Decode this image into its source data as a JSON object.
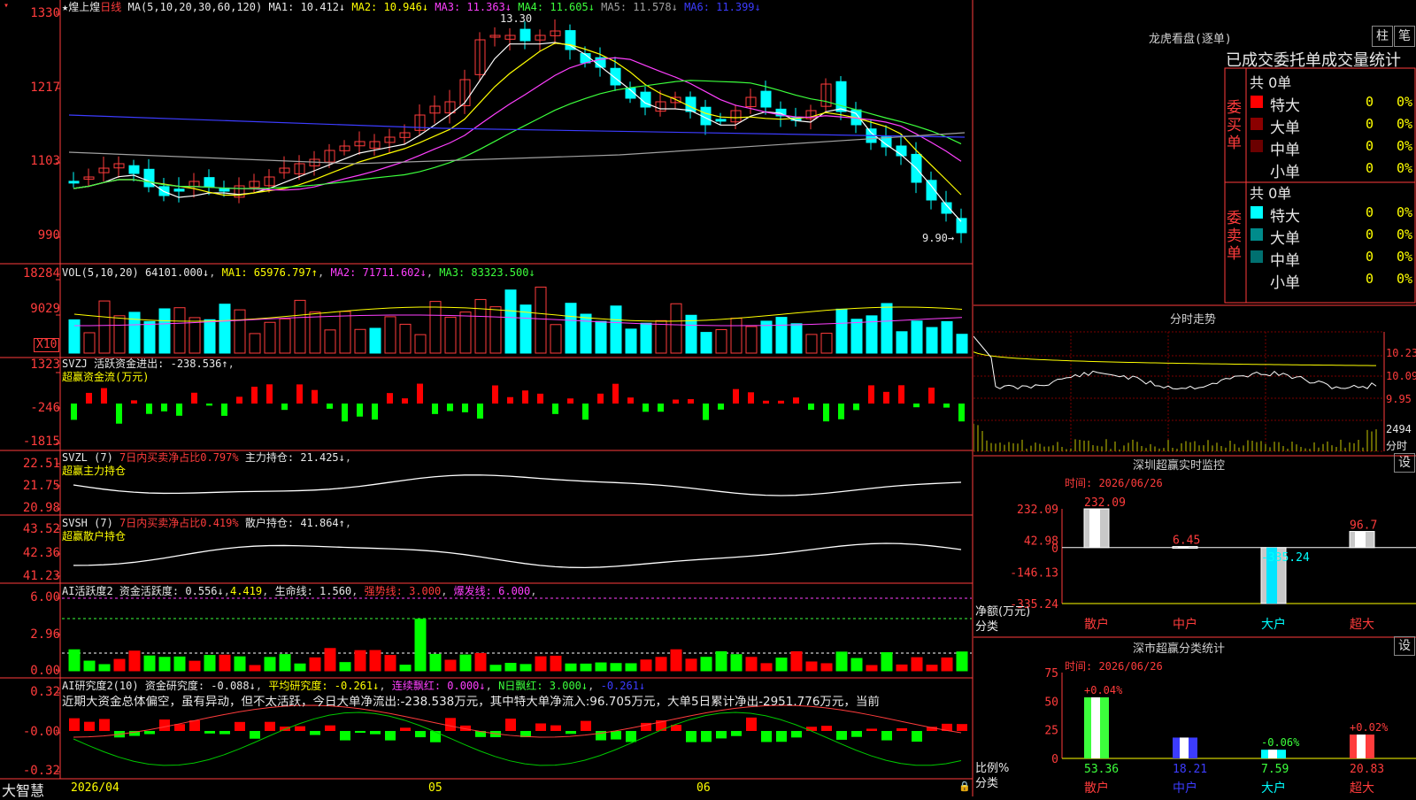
{
  "app": {
    "brand": "大智慧",
    "stock_name": "煌上煌",
    "period": "日线"
  },
  "price_panel": {
    "ma_label": "MA(5,10,20,30,60,120)",
    "ma_values": [
      {
        "name": "MA1",
        "value": "10.412↓",
        "color": "#e8e8e8"
      },
      {
        "name": "MA2",
        "value": "10.946↓",
        "color": "#ffff00"
      },
      {
        "name": "MA3",
        "value": "11.363↓",
        "color": "#ff40ff"
      },
      {
        "name": "MA4",
        "value": "11.605↓",
        "color": "#3cff3c"
      },
      {
        "name": "MA5",
        "value": "11.578↓",
        "color": "#a0a0a0"
      },
      {
        "name": "MA6",
        "value": "11.399↓",
        "color": "#3c3cff"
      }
    ],
    "yticks": [
      "1330",
      "1217",
      "1103",
      "990"
    ],
    "high_label": "13.30",
    "low_label": "9.90"
  },
  "vol_panel": {
    "label": "VOL(5,10,20)",
    "value": "64101.000↓",
    "ma1": "65976.797↑",
    "ma2": "71711.602↓",
    "ma3": "83323.500↓",
    "yticks": [
      "18284",
      "9029"
    ],
    "unit": "X10"
  },
  "svzj_panel": {
    "label": "SVZJ",
    "title": "活跃资金进出:",
    "value": "-238.536↑",
    "subtitle": "超赢资金流(万元)",
    "yticks": [
      "1323",
      "-246",
      "-1815"
    ]
  },
  "svzl_panel": {
    "label": "SVZL (7)",
    "ratio": "7日内买卖净占比0.797%",
    "title": "主力持仓:",
    "value": "21.425↓",
    "subtitle": "超赢主力持仓",
    "yticks": [
      "22.51",
      "21.75",
      "20.98"
    ]
  },
  "svsh_panel": {
    "label": "SVSH (7)",
    "ratio": "7日内买卖净占比0.419%",
    "title": "散户持仓:",
    "value": "41.864↑",
    "subtitle": "超赢散户持仓",
    "yticks": [
      "43.52",
      "42.36",
      "41.23"
    ]
  },
  "ai2_panel": {
    "label": "AI活跃度2",
    "t1": "资金活跃度:",
    "v1": "0.556↓",
    "v1b": "4.419",
    "t2": "生命线:",
    "v2": "1.560",
    "t3": "强势线:",
    "v3": "3.000",
    "t4": "爆发线:",
    "v4": "6.000",
    "yticks": [
      "6.00",
      "2.96",
      "0.00"
    ]
  },
  "ai_research_panel": {
    "label": "AI研究度2(10)",
    "t1": "资金研究度:",
    "v1": "-0.088↓",
    "t2": "平均研究度:",
    "v2": "-0.261↓",
    "t3": "连续飘红:",
    "v3": "0.000↓",
    "t4": "N日飘红:",
    "v4": "3.000↓",
    "v5": "-0.261↓",
    "commentary": "近期大资金总体偏空，虽有异动，但不太活跃，今日大单净流出:-238.538万元，其中特大单净流入:96.705万元，大单5日累计净出-2951.776万元，当前",
    "yticks": [
      "0.32",
      "-0.00",
      "-0.32"
    ]
  },
  "xaxis": {
    "labels": [
      "2026/04",
      "05",
      "06"
    ]
  },
  "right_panel": {
    "lhb_title": "龙虎看盘(逐单)",
    "buttons": [
      "柱",
      "笔"
    ],
    "stats_title": "已成交委托单成交量统计",
    "buy": {
      "side": "委买单",
      "total": "共 0单",
      "rows": [
        {
          "label": "特大",
          "count": "0",
          "pct": "0%",
          "color": "#ff0000"
        },
        {
          "label": "大单",
          "count": "0",
          "pct": "0%",
          "color": "#8b0000"
        },
        {
          "label": "中单",
          "count": "0",
          "pct": "0%",
          "color": "#6b0000"
        },
        {
          "label": "小单",
          "count": "0",
          "pct": "0%",
          "color": ""
        }
      ]
    },
    "sell": {
      "side": "委卖单",
      "total": "共 0单",
      "rows": [
        {
          "label": "特大",
          "count": "0",
          "pct": "0%",
          "color": "#00ffff"
        },
        {
          "label": "大单",
          "count": "0",
          "pct": "0%",
          "color": "#008b8b"
        },
        {
          "label": "中单",
          "count": "0",
          "pct": "0%",
          "color": "#007070"
        },
        {
          "label": "小单",
          "count": "0",
          "pct": "0%",
          "color": ""
        }
      ]
    },
    "intraday_title": "分时走势",
    "intraday_yticks": [
      "10.23",
      "10.09",
      "9.95"
    ],
    "intraday_vol": "2494",
    "intraday_unit": "分时",
    "monitor_title": "深圳超赢实时监控",
    "monitor_time": "时间: 2026/06/26",
    "monitor_set": "设",
    "monitor_yticks": [
      "232.09",
      "42.98",
      "0",
      "-146.13",
      "-335.24"
    ],
    "monitor_ylabel": "净额(万元)",
    "monitor_xlabel": "分类",
    "classify_title": "深市超赢分类统计",
    "classify_time": "时间: 2026/06/26",
    "classify_set": "设",
    "classify_yticks": [
      "75",
      "50",
      "25",
      "0"
    ],
    "classify_ylabel": "比例%",
    "classify_xlabel": "分类"
  },
  "chart_data": [
    {
      "type": "bar",
      "title": "深圳超赢实时监控",
      "categories": [
        "散户",
        "中户",
        "大户",
        "超大"
      ],
      "values": [
        232.09,
        6.45,
        -335.24,
        96.7
      ],
      "ylim": [
        -335.24,
        232.09
      ]
    },
    {
      "type": "bar",
      "title": "深市超赢分类统计",
      "categories": [
        "散户",
        "中户",
        "大户",
        "超大"
      ],
      "values": [
        53.36,
        18.21,
        7.59,
        20.83
      ],
      "changes": [
        "+0.04%",
        "",
        "-0.06%",
        "+0.02%"
      ],
      "ylim": [
        0,
        75
      ]
    }
  ]
}
